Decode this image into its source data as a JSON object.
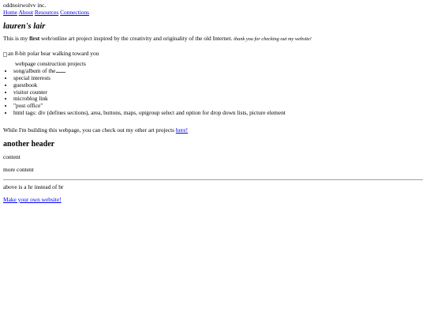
{
  "header": {
    "company": "oddnoirwolvv inc."
  },
  "nav": [
    {
      "label": "Home"
    },
    {
      "label": "About"
    },
    {
      "label": "Resources"
    },
    {
      "label": "Connections"
    }
  ],
  "page_title": "lauren's lair",
  "intro": {
    "before": "This is my ",
    "strong": "first",
    "after": " web/online art project inspired by the creativity and originality of the old Internet. ",
    "thanks": "thank you for checking out my website!"
  },
  "image": {
    "alt": "an 8-bit polar bear walking toward you"
  },
  "todo": [
    "webpage construction projects",
    "song/album of the",
    "special interests",
    "guestbook",
    "visitor counter",
    "microblog link",
    "\"post office\"",
    "html tags: div (defines sections), area, buttons, maps, optgroup select and option for drop down lists, picture element"
  ],
  "wip": {
    "text": "While I'm building this webpage, you can check out my other art projects ",
    "link": "here!"
  },
  "section2": {
    "title": "another header",
    "content": "content",
    "more": "more content"
  },
  "hr_note": "above is a hr instead of br",
  "footer_link": "Make your own website!",
  "colors": {
    "link": "#0000ee",
    "text": "#000000",
    "background": "#ffffff"
  }
}
